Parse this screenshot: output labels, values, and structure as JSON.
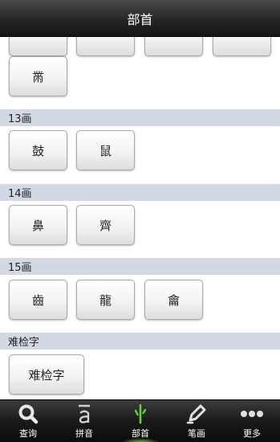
{
  "header": {
    "title": "部首"
  },
  "sections": [
    {
      "label": "",
      "items": [
        "",
        "",
        "",
        ""
      ]
    },
    {
      "label": "",
      "items": [
        "黹"
      ]
    },
    {
      "label": "13画",
      "items": [
        "鼓",
        "鼠"
      ]
    },
    {
      "label": "14画",
      "items": [
        "鼻",
        "齊"
      ]
    },
    {
      "label": "15画",
      "items": [
        "齒",
        "龍",
        "龠"
      ]
    },
    {
      "label": "难检字",
      "items": [
        "难检字"
      ]
    }
  ],
  "tabs": [
    {
      "label": "查询",
      "icon": "search-icon"
    },
    {
      "label": "拼音",
      "icon": "pinyin-icon"
    },
    {
      "label": "部首",
      "icon": "radical-icon",
      "active": true
    },
    {
      "label": "笔画",
      "icon": "pencil-icon"
    },
    {
      "label": "更多",
      "icon": "more-icon"
    }
  ],
  "colors": {
    "section_header_bg": "#d3d9e3",
    "active_glow": "#78dc3c",
    "active_icon": "#66d23c"
  }
}
